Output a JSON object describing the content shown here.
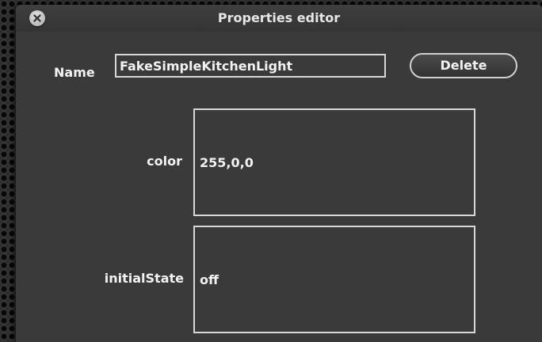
{
  "window": {
    "title": "Properties editor"
  },
  "name_row": {
    "label": "Name",
    "value": "FakeSimpleKitchenLight",
    "delete_label": "Delete"
  },
  "properties": [
    {
      "label": "color",
      "value": "255,0,0"
    },
    {
      "label": "initialState",
      "value": "off"
    }
  ],
  "icons": {
    "close": "close-icon"
  },
  "colors": {
    "window_bg": "#3a3a3a",
    "text": "#f2f2f2",
    "field_border": "#d8d8d8",
    "close_button": "#c4c4c4"
  }
}
